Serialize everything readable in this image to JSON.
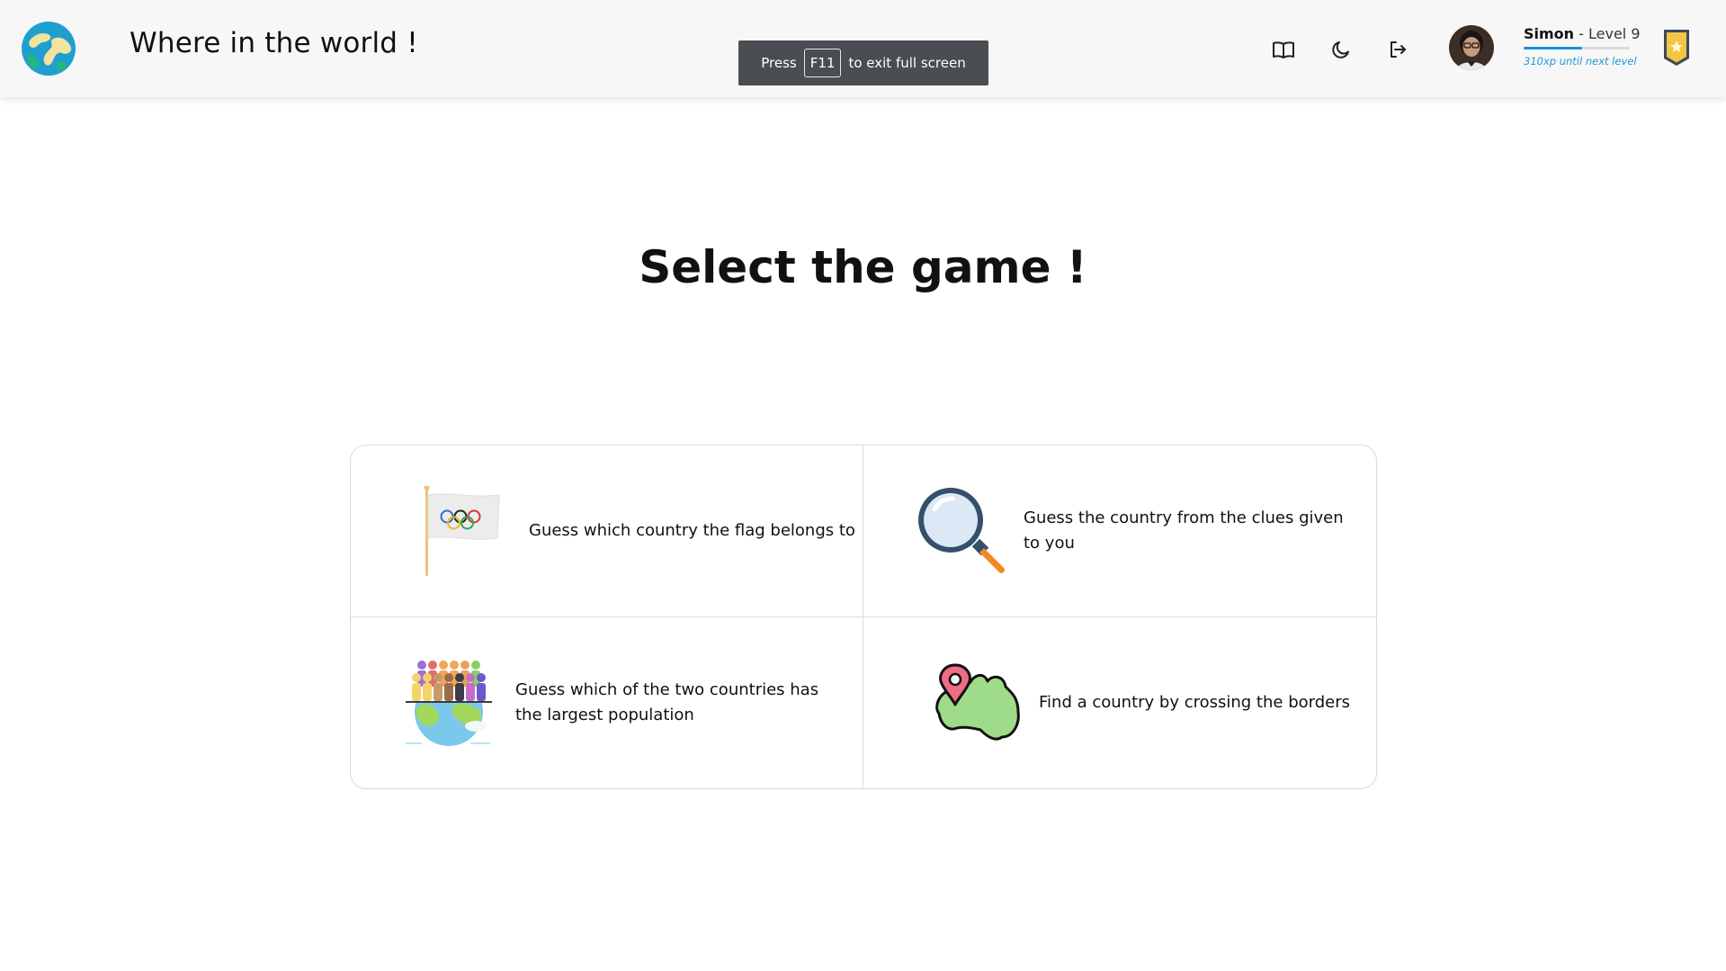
{
  "app": {
    "title": "Where in the world !"
  },
  "fullscreen_toast": {
    "prefix": "Press",
    "key": "F11",
    "suffix": "to exit full screen"
  },
  "nav_icons": [
    "book-icon",
    "moon-icon",
    "logout-icon"
  ],
  "user": {
    "name": "Simon",
    "level_text": "- Level 9",
    "xp_text": "310xp until next level",
    "xp_progress": 0.55
  },
  "page": {
    "heading": "Select the game !"
  },
  "games": [
    {
      "icon": "olympic-flag-icon",
      "description": "Guess which country the flag belongs to"
    },
    {
      "icon": "magnifying-glass-icon",
      "description": "Guess the country from the clues given to you"
    },
    {
      "icon": "population-globe-icon",
      "description": "Guess which of the two countries has the largest population"
    },
    {
      "icon": "map-pin-country-icon",
      "description": "Find a country by crossing the borders"
    }
  ],
  "colors": {
    "accent": "#1a8fd9",
    "toast_bg": "#4a4d51",
    "badge_gold": "#f4c542",
    "badge_border": "#3b4a5a"
  }
}
